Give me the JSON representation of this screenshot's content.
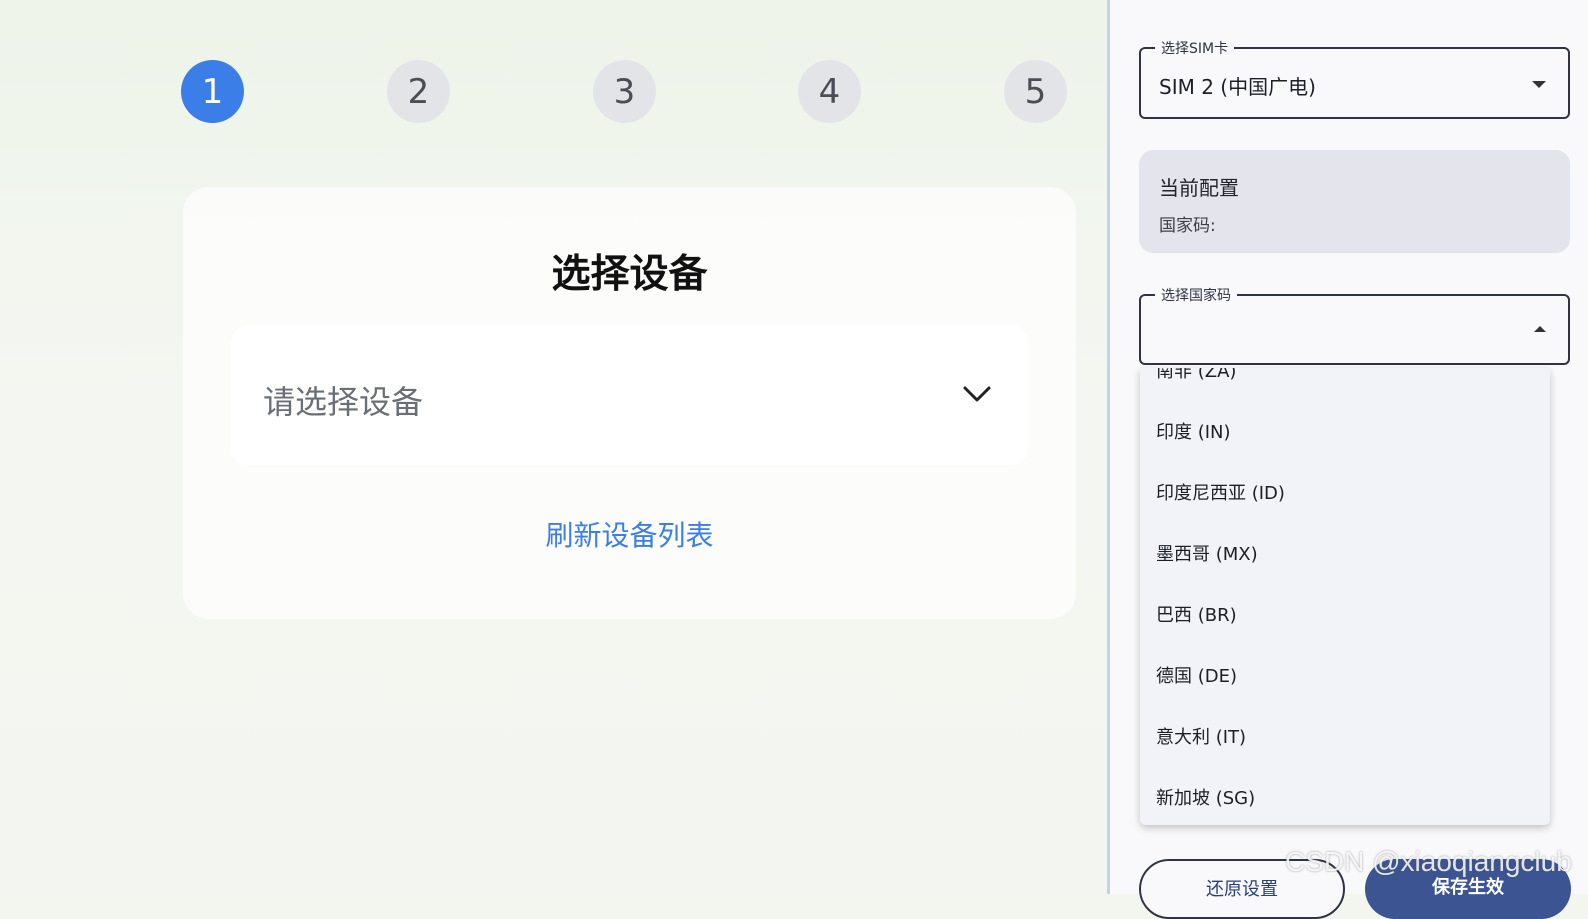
{
  "steps": [
    "1",
    "2",
    "3",
    "4",
    "5"
  ],
  "active_step": 1,
  "card": {
    "title": "选择设备",
    "device_placeholder": "请选择设备",
    "refresh_link": "刷新设备列表"
  },
  "panel": {
    "sim_field": {
      "legend": "选择SIM卡",
      "value": "SIM 2 (中国广电)"
    },
    "current_config": {
      "title": "当前配置",
      "country_code_label": "国家码:"
    },
    "country_field": {
      "legend": "选择国家码",
      "value": ""
    },
    "country_options": [
      "南非 (ZA)",
      "印度 (IN)",
      "印度尼西亚 (ID)",
      "墨西哥 (MX)",
      "巴西 (BR)",
      "德国 (DE)",
      "意大利 (IT)",
      "新加坡 (SG)"
    ],
    "reset_button": "还原设置",
    "save_button": "保存生效"
  },
  "watermark": "CSDN @xiaoqiangclub",
  "colors": {
    "accent": "#3b7ee8",
    "save_button": "#3c5592",
    "step_inactive": "#e2e4e8"
  }
}
